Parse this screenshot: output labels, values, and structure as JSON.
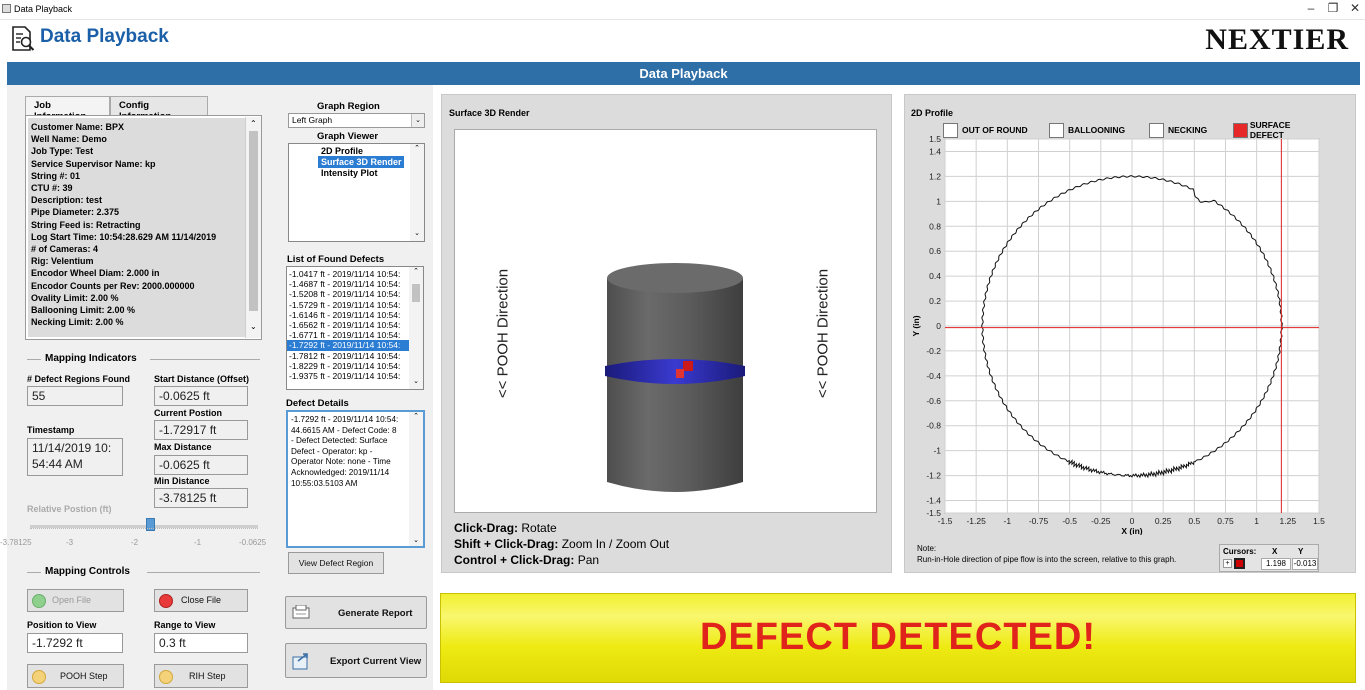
{
  "window": {
    "title": "Data Playback",
    "minimize_glyph": "–",
    "restore_glyph": "❐",
    "close_glyph": "✕"
  },
  "header": {
    "title": "Data Playback",
    "logo_text": "NEXTIER",
    "icon": "document-search-icon"
  },
  "banner": {
    "title": "Data Playback"
  },
  "tabs": [
    {
      "label": "Job Information",
      "active": true
    },
    {
      "label": "Config Information",
      "active": false
    }
  ],
  "job_info": [
    "Customer Name: BPX",
    "Well Name: Demo",
    "Job Type: Test",
    "Service Supervisor Name: kp",
    "String #: 01",
    "CTU #: 39",
    "Description: test",
    "Pipe Diameter: 2.375",
    "String Feed is: Retracting",
    "Log Start Time: 10:54:28.629 AM 11/14/2019",
    "# of Cameras: 4",
    "Rig: Velentium",
    "Encodor Wheel Diam: 2.000 in",
    "Encodor Counts per Rev: 2000.000000",
    "Ovality Limit: 2.00 %",
    "Ballooning Limit: 2.00 %",
    "Necking Limit: 2.00 %"
  ],
  "mapping_indicators": {
    "title": "Mapping Indicators",
    "defect_regions_label": "# Defect Regions Found",
    "defect_regions_value": "55",
    "timestamp_label": "Timestamp",
    "timestamp_value": "11/14/2019 10:\n54:44 AM",
    "start_distance_label": "Start Distance (Offset)",
    "start_distance_value": "-0.0625 ft",
    "current_position_label": "Current Postion",
    "current_position_value": "-1.72917 ft",
    "max_distance_label": "Max Distance",
    "max_distance_value": "-0.0625 ft",
    "min_distance_label": "Min Distance",
    "min_distance_value": "-3.78125 ft",
    "relative_position_label": "Relative Postion (ft)",
    "slider_ticks": [
      "-3.78125",
      "-3",
      "-2",
      "-1",
      "-0.0625"
    ],
    "slider_value": 0.54
  },
  "mapping_controls": {
    "title": "Mapping Controls",
    "open_file": "Open File",
    "close_file": "Close File",
    "position_label": "Position to View",
    "position_value": "-1.7292 ft",
    "range_label": "Range to View",
    "range_value": "0.3 ft",
    "pooh_step": "POOH Step",
    "rih_step": "RIH Step"
  },
  "graph_region": {
    "label": "Graph Region",
    "selected": "Left Graph"
  },
  "graph_viewer": {
    "label": "Graph Viewer",
    "options": [
      "2D Profile",
      "Surface 3D Render",
      "Intensity Plot"
    ],
    "selected_index": 1
  },
  "defects": {
    "label": "List of Found Defects",
    "items": [
      "-1.0417 ft - 2019/11/14 10:54:",
      "-1.4687 ft - 2019/11/14 10:54:",
      "-1.5208 ft - 2019/11/14 10:54:",
      "-1.5729 ft - 2019/11/14 10:54:",
      "-1.6146 ft - 2019/11/14 10:54:",
      "-1.6562 ft - 2019/11/14 10:54:",
      "-1.6771 ft - 2019/11/14 10:54:",
      "-1.7292 ft - 2019/11/14 10:54:",
      "-1.7812 ft - 2019/11/14 10:54:",
      "-1.8229 ft - 2019/11/14 10:54:",
      "-1.9375 ft - 2019/11/14 10:54:"
    ],
    "selected_index": 7
  },
  "defect_details": {
    "label": "Defect Details",
    "text": "-1.7292 ft - 2019/11/14 10:54:\n44.6615 AM - Defect Code: 8\n- Defect Detected: Surface\nDefect - Operator: kp -\nOperator Note: none - Time\nAcknowledged: 2019/11/14\n10:55:03.5103 AM"
  },
  "buttons": {
    "view_defect_region": "View Defect Region",
    "generate_report": "Generate Report",
    "export_view": "Export Current View"
  },
  "render3d": {
    "title": "Surface 3D Render",
    "direction_left": "<< POOH Direction",
    "direction_right": "<< POOH Direction",
    "help": [
      {
        "key": "Click-Drag:",
        "value": "Rotate"
      },
      {
        "key": "Shift + Click-Drag:",
        "value": "Zoom In / Zoom Out"
      },
      {
        "key": "Control + Click-Drag:",
        "value": "Pan"
      }
    ]
  },
  "profile2d": {
    "title": "2D Profile",
    "legend": [
      {
        "label": "OUT OF ROUND",
        "color": "#ffffff"
      },
      {
        "label": "BALLOONING",
        "color": "#ffffff"
      },
      {
        "label": "NECKING",
        "color": "#ffffff"
      },
      {
        "label": "SURFACE DEFECT",
        "color": "#e62828"
      }
    ],
    "note": "Note:\nRun-in-Hole direction of pipe flow is into the screen, relative to this graph.",
    "cursors": {
      "label": "Cursors:",
      "x_label": "X",
      "y_label": "Y",
      "x": "1.198",
      "y": "-0.013"
    }
  },
  "alert": {
    "text": "DEFECT DETECTED!"
  },
  "chart_data": {
    "type": "scatter",
    "title": "2D Profile",
    "xlabel": "X (in)",
    "ylabel": "Y (in)",
    "xlim": [
      -1.5,
      1.5
    ],
    "ylim": [
      -1.5,
      1.5
    ],
    "x_ticks": [
      "-1.5",
      "-1.25",
      "-1",
      "-0.75",
      "-0.5",
      "-0.25",
      "0",
      "0.25",
      "0.5",
      "0.75",
      "1",
      "1.25",
      "1.5"
    ],
    "y_ticks": [
      "1.5",
      "1.4",
      "1.2",
      "1",
      "0.8",
      "0.6",
      "0.4",
      "0.2",
      "0",
      "-0.2",
      "-0.4",
      "-0.6",
      "-0.8",
      "-1",
      "-1.2",
      "-1.4",
      "-1.5"
    ],
    "series": [
      {
        "radius": 1.2,
        "center": [
          0,
          0
        ],
        "defect_dip_at_deg": 63
      }
    ],
    "cursor": {
      "x": 1.198,
      "y": -0.013
    },
    "grid": true
  }
}
